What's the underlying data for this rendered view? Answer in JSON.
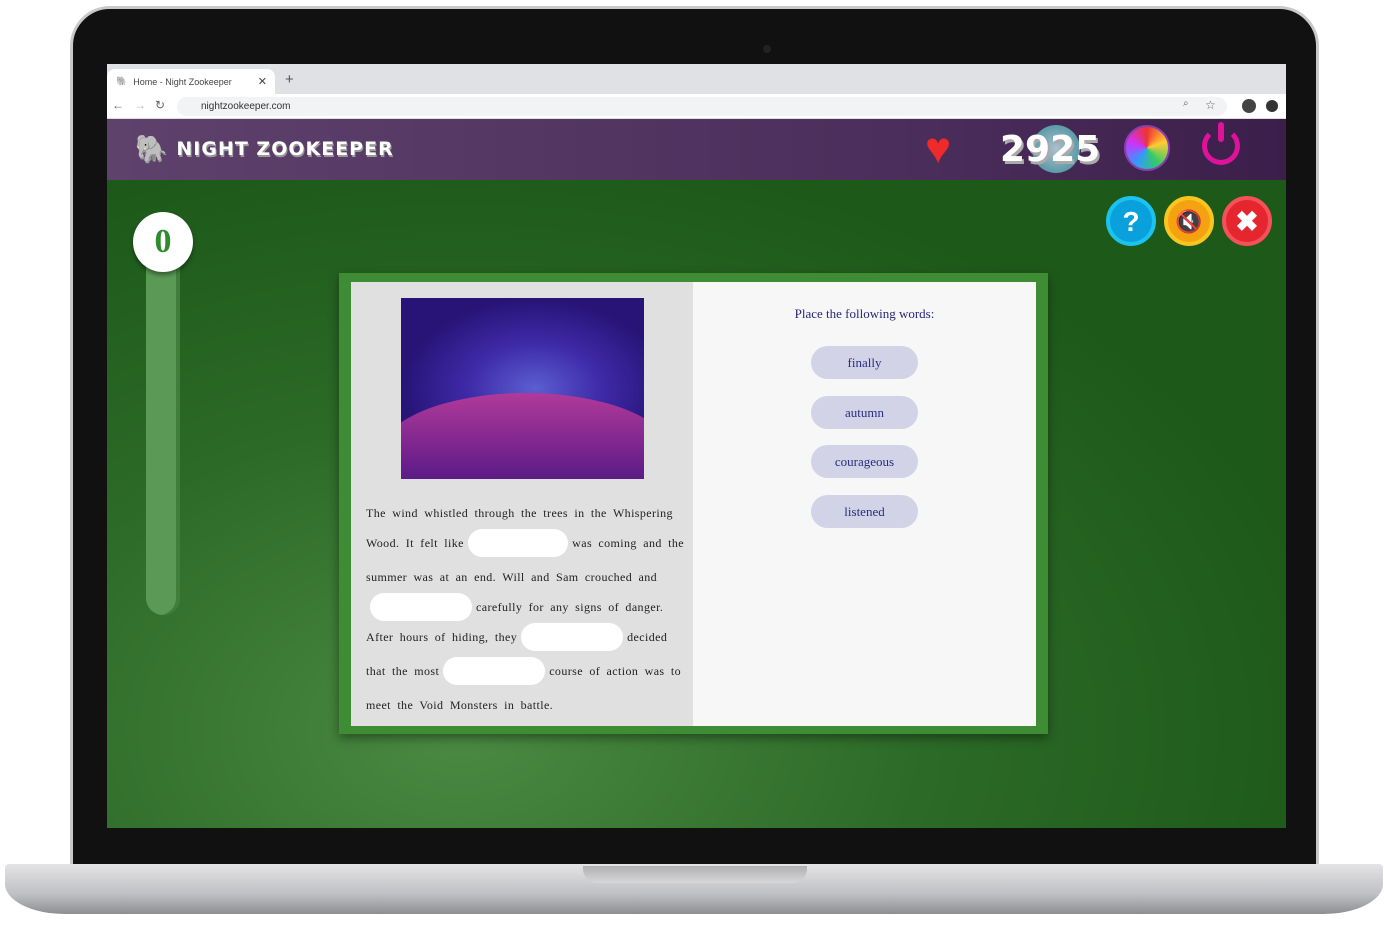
{
  "browser": {
    "tab_title": "Home - Night Zookeeper",
    "url": "nightzookeeper.com"
  },
  "header": {
    "brand": "NIGHT ZOOKEEPER",
    "score": "2925"
  },
  "game": {
    "counter": "0",
    "story_lines": [
      [
        "The wind whistled through the trees in the Whispering"
      ],
      [
        "Wood. It felt like",
        "",
        "was coming and the"
      ],
      [
        "summer was at an end. Will and Sam crouched and"
      ],
      [
        "",
        "carefully for any signs of danger."
      ],
      [
        "After hours of hiding, they",
        "",
        "decided"
      ],
      [
        "that the most",
        "",
        "course of action was to"
      ],
      [
        "meet the Void Monsters in battle."
      ]
    ],
    "prompt": "Place the following words:",
    "words": [
      "finally",
      "autumn",
      "courageous",
      "listened"
    ]
  },
  "colors": {
    "header": "#4a2d5a",
    "game_bg": "#1d5a1a",
    "card_border": "#3e8c33",
    "word_chip": "#d2d3e6"
  }
}
